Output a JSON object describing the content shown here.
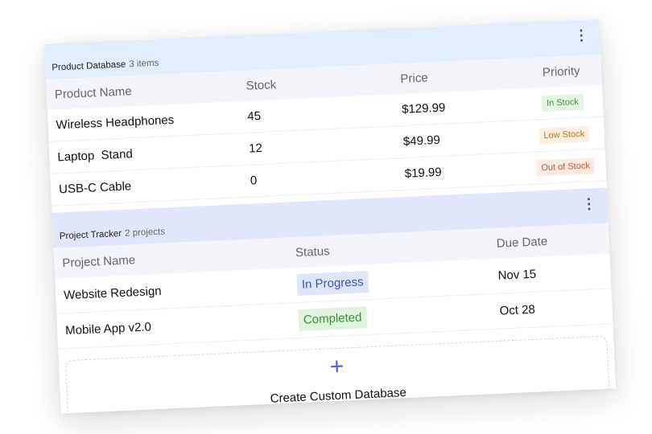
{
  "products": {
    "title": "Product Database",
    "count": "3 items",
    "more_icon": "⋮",
    "columns": [
      "Product Name",
      "Stock",
      "Price",
      "Priority"
    ],
    "rows": [
      {
        "name": "Wireless Headphones",
        "stock": "45",
        "price": "$129.99",
        "priority": "In Stock"
      },
      {
        "name": "Laptop  Stand",
        "stock": "12",
        "price": "$49.99",
        "priority": "Low Stock"
      },
      {
        "name": "USB-C Cable",
        "stock": "0",
        "price": "$19.99",
        "priority": "Out of Stock"
      }
    ],
    "priority_colors": {
      "In Stock": {
        "bg": "#e6f4e6",
        "fg": "#3f8f3f"
      },
      "Low Stock": {
        "bg": "#fdf0e2",
        "fg": "#c0722a"
      },
      "Out of Stock": {
        "bg": "#fdebe2",
        "fg": "#c05a2a"
      }
    }
  },
  "projects": {
    "title": "Project Tracker",
    "count": "2 projects",
    "more_icon": "⋮",
    "columns": [
      "Project Name",
      "Status",
      "Due Date"
    ],
    "rows": [
      {
        "name": "Website Redesign",
        "status": "In Progress",
        "due": "Nov 15"
      },
      {
        "name": "Mobile App v2.0",
        "status": "Completed",
        "due": "Oct 28"
      }
    ],
    "status_colors": {
      "In Progress": {
        "bg": "#dfe5fb",
        "fg": "#3b55c4"
      },
      "Completed": {
        "bg": "#dff3df",
        "fg": "#3f8f3f"
      }
    }
  },
  "create": {
    "icon": "+",
    "label": "Create Custom Database"
  }
}
